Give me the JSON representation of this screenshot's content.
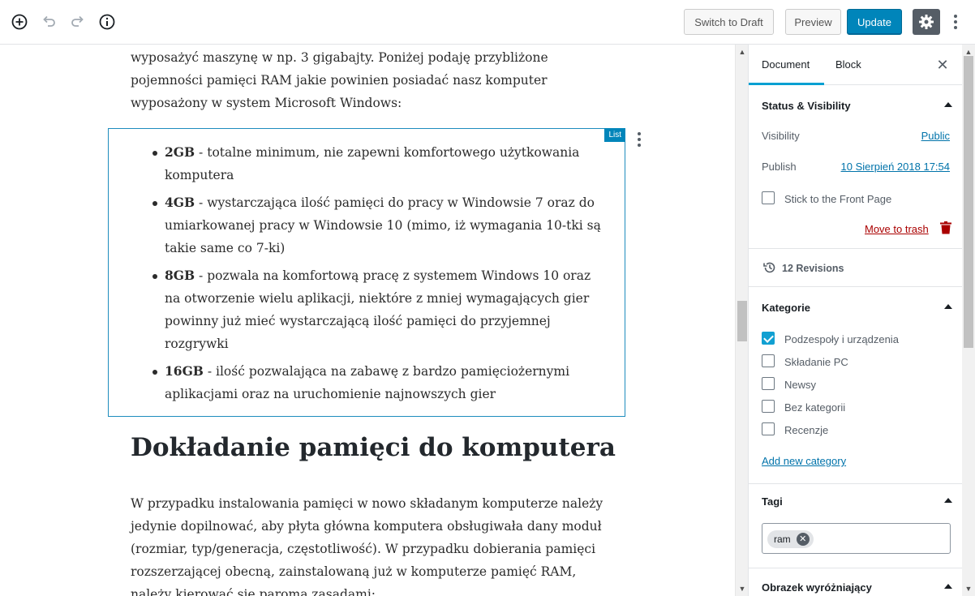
{
  "toolbar": {
    "add_block_icon": "plus-circle-icon",
    "undo_icon": "undo-icon",
    "redo_icon": "redo-icon",
    "info_icon": "info-icon",
    "switch_to_draft": "Switch to Draft",
    "preview": "Preview",
    "update": "Update",
    "settings_icon": "gear-icon",
    "more_icon": "more-vertical-icon"
  },
  "editor": {
    "intro_paragraph": "wyposażyć maszynę w np. 3 gigabajty. Poniżej podaję przybliżone pojemności pamięci RAM jakie powinien posiadać nasz komputer wyposażony w system Microsoft Windows:",
    "list_block_label": "List",
    "list_items": [
      {
        "bold": "2GB",
        "text": " - totalne minimum, nie zapewni komfortowego użytkowania komputera"
      },
      {
        "bold": "4GB",
        "text": " - wystarczająca ilość pamięci do pracy w Windowsie 7 oraz do umiarkowanej pracy w Windowsie 10 (mimo, iż wymagania 10-tki są takie same co 7-ki)"
      },
      {
        "bold": "8GB",
        "text": " - pozwala na komfortową pracę z systemem Windows 10 oraz na otworzenie wielu aplikacji, niektóre z mniej wymagających gier powinny już mieć wystarczającą ilość pamięci do przyjemnej rozgrywki"
      },
      {
        "bold": "16GB",
        "text": " - ilość pozwalająca na zabawę z bardzo pamięciożernymi aplikacjami oraz na uruchomienie najnowszych gier"
      }
    ],
    "heading": "Dokładanie pamięci do komputera",
    "body_paragraph": "W przypadku instalowania pamięci w nowo składanym komputerze należy jedynie dopilnować, aby płyta główna komputera obsługiwała dany moduł (rozmiar, typ/generacja, częstotliwość). W przypadku dobierania pamięci rozszerzającej obecną, zainstalowaną już w komputerze pamięć RAM, należy kierować się paroma zasadami:"
  },
  "sidebar": {
    "tabs": {
      "document": "Document",
      "block": "Block",
      "close": "✕"
    },
    "status": {
      "title": "Status & Visibility",
      "visibility_label": "Visibility",
      "visibility_value": "Public",
      "publish_label": "Publish",
      "publish_value": "10 Sierpień 2018 17:54",
      "sticky_label": "Stick to the Front Page",
      "sticky_checked": false,
      "trash_label": "Move to trash"
    },
    "revisions": {
      "label": "12 Revisions",
      "icon": "history-icon"
    },
    "categories": {
      "title": "Kategorie",
      "items": [
        {
          "label": "Podzespoły i urządzenia",
          "checked": true
        },
        {
          "label": "Składanie PC",
          "checked": false
        },
        {
          "label": "Newsy",
          "checked": false
        },
        {
          "label": "Bez kategorii",
          "checked": false
        },
        {
          "label": "Recenzje",
          "checked": false
        }
      ],
      "add_new": "Add new category"
    },
    "tags": {
      "title": "Tagi",
      "items": [
        "ram"
      ]
    },
    "featured_image": {
      "title": "Obrazek wyróżniający"
    }
  },
  "colors": {
    "primary": "#0085ba",
    "accent": "#00a0d2",
    "link": "#0073aa",
    "danger": "#a00"
  }
}
